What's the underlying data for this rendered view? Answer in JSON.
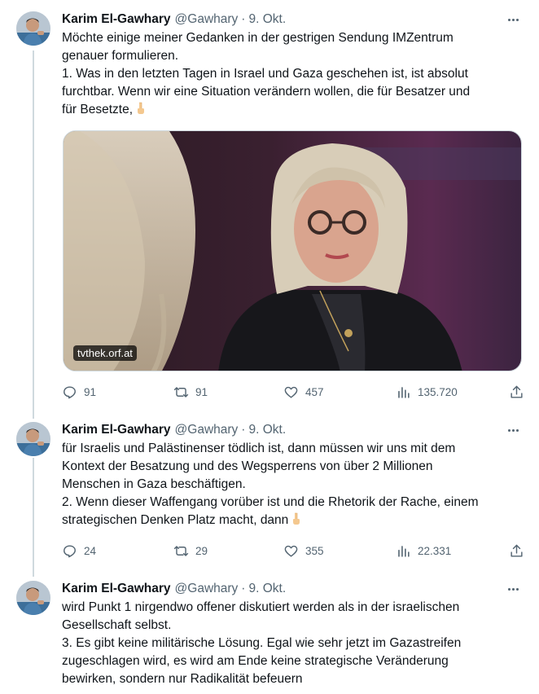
{
  "tweets": [
    {
      "author": {
        "name": "Karim El-Gawhary",
        "handle": "@Gawhary"
      },
      "date": "9. Okt.",
      "text_lines": [
        "Möchte einige meiner Gedanken in der gestrigen Sendung IMZentrum",
        "genauer formulieren.",
        "1. Was in den letzten Tagen in Israel und Gaza geschehen ist, ist absolut",
        "furchtbar. Wenn wir eine Situation verändern wollen, die für Besatzer und",
        "für Besetzte,"
      ],
      "emoji": "pointing-down-hand-icon",
      "media": {
        "source_label": "tvthek.orf.at"
      },
      "stats": {
        "replies": "91",
        "retweets": "91",
        "likes": "457",
        "views": "135.720"
      }
    },
    {
      "author": {
        "name": "Karim El-Gawhary",
        "handle": "@Gawhary"
      },
      "date": "9. Okt.",
      "text_lines": [
        "für Israelis und Palästinenser tödlich ist, dann müssen wir uns mit dem",
        "Kontext der Besatzung und des Wegsperrens von über 2 Millionen",
        "Menschen in Gaza beschäftigen.",
        "2. Wenn dieser Waffengang vorüber ist und die Rhetorik der Rache, einem",
        "strategischen Denken Platz macht, dann"
      ],
      "emoji": "pointing-down-hand-icon",
      "stats": {
        "replies": "24",
        "retweets": "29",
        "likes": "355",
        "views": "22.331"
      }
    },
    {
      "author": {
        "name": "Karim El-Gawhary",
        "handle": "@Gawhary"
      },
      "date": "9. Okt.",
      "text_lines": [
        "wird Punkt 1 nirgendwo offener diskutiert werden als in der israelischen",
        "Gesellschaft selbst.",
        "3. Es gibt keine militärische Lösung. Egal wie sehr jetzt im Gazastreifen",
        "zugeschlagen wird, es wird am Ende keine strategische Veränderung",
        "bewirken, sondern nur Radikalität befeuern"
      ]
    }
  ],
  "colors": {
    "text": "#0f1419",
    "secondary": "#536471",
    "thread_line": "#cfd9de"
  }
}
